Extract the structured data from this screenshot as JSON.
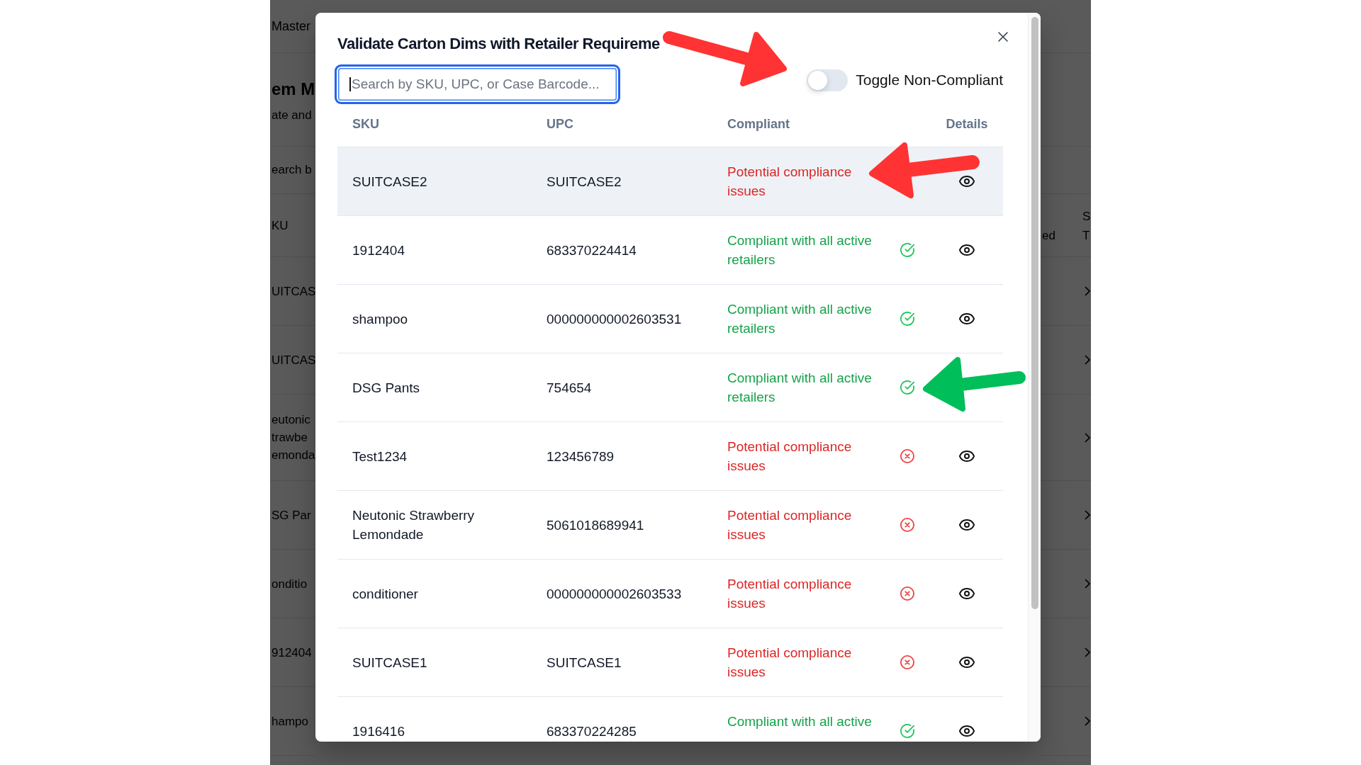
{
  "backdrop_page": {
    "nav_label": "Master",
    "heading": "em M",
    "subheading": "ate and",
    "search_placeholder": "earch b",
    "columns": {
      "column_1": "KU",
      "column_2": "ed",
      "column_3": "S T"
    },
    "rows": [
      {
        "lines": [
          "UITCAS"
        ]
      },
      {
        "lines": [
          "UITCAS"
        ]
      },
      {
        "lines": [
          "eutonic",
          "trawbe",
          "emonda"
        ]
      },
      {
        "lines": [
          "SG Par"
        ]
      },
      {
        "lines": [
          "onditio"
        ]
      },
      {
        "lines": [
          "912404"
        ]
      },
      {
        "lines": [
          "hampo"
        ]
      }
    ]
  },
  "dialog": {
    "title": "Validate Carton Dims with Retailer Requireme",
    "search": {
      "placeholder": "Search by SKU, UPC, or Case Barcode...",
      "focused": true
    },
    "toggle": {
      "label": "Toggle Non-Compliant",
      "on": false
    },
    "table": {
      "columns": [
        "SKU",
        "UPC",
        "Compliant",
        "Details"
      ],
      "rows": [
        {
          "sku": "SUITCASE2",
          "upc": "SUITCASE2",
          "status": "Potential compliance issues",
          "compliant": false,
          "highlighted": true,
          "status_icon_visible": false,
          "details_icon_visible": true
        },
        {
          "sku": "1912404",
          "upc": "683370224414",
          "status": "Compliant with all active retailers",
          "compliant": true,
          "highlighted": false,
          "status_icon_visible": true,
          "details_icon_visible": true
        },
        {
          "sku": "shampoo",
          "upc": "000000000002603531",
          "status": "Compliant with all active retailers",
          "compliant": true,
          "highlighted": false,
          "status_icon_visible": true,
          "details_icon_visible": true
        },
        {
          "sku": "DSG Pants",
          "upc": "754654",
          "status": "Compliant with all active retailers",
          "compliant": true,
          "highlighted": false,
          "status_icon_visible": true,
          "details_icon_visible": false
        },
        {
          "sku": "Test1234",
          "upc": "123456789",
          "status": "Potential compliance issues",
          "compliant": false,
          "highlighted": false,
          "status_icon_visible": true,
          "details_icon_visible": true
        },
        {
          "sku": "Neutonic Strawberry Lemondade",
          "upc": "5061018689941",
          "status": "Potential compliance issues",
          "compliant": false,
          "highlighted": false,
          "status_icon_visible": true,
          "details_icon_visible": true
        },
        {
          "sku": "conditioner",
          "upc": "000000000002603533",
          "status": "Potential compliance issues",
          "compliant": false,
          "highlighted": false,
          "status_icon_visible": true,
          "details_icon_visible": true
        },
        {
          "sku": "SUITCASE1",
          "upc": "SUITCASE1",
          "status": "Potential compliance issues",
          "compliant": false,
          "highlighted": false,
          "status_icon_visible": true,
          "details_icon_visible": true
        },
        {
          "sku": "1916416",
          "upc": "683370224285",
          "status": "Compliant with all active",
          "compliant": true,
          "highlighted": false,
          "status_icon_visible": true,
          "details_icon_visible": true
        }
      ]
    }
  },
  "annotations": [
    {
      "color": "#ff3333"
    },
    {
      "color": "#ff3333"
    },
    {
      "color": "#00be5a"
    }
  ]
}
